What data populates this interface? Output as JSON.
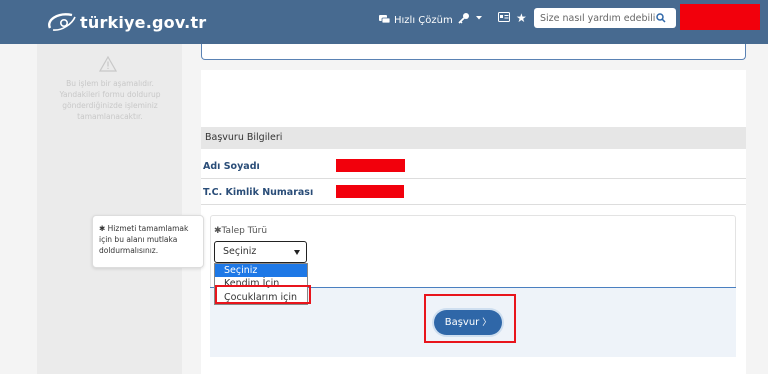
{
  "header": {
    "logo_text": "türkiye.gov.tr",
    "logo_subtext": "",
    "quick_solution_label": "Hızlı Çözüm",
    "search_placeholder": "Size nasıl yardım edebilirim?",
    "icons": [
      "chat-icon",
      "key-icon",
      "id-card-icon",
      "star-icon",
      "search-icon"
    ],
    "colors": {
      "header_bg": "#476a90",
      "redaction": "#f2000c"
    }
  },
  "left_panel": {
    "message": "Bu işlem bir aşamalıdır. Yandakileri formu doldurup gönderdiğinizde işleminiz tamamlanacaktır.",
    "icon": "warning-icon"
  },
  "section": {
    "title": "Başvuru Bilgileri",
    "fields": [
      {
        "label": "Adı Soyadı"
      },
      {
        "label": "T.C. Kimlik Numarası"
      }
    ]
  },
  "tooltip": {
    "text": "✱ Hizmeti tamamlamak için bu alanı mutlaka doldurmalısınız."
  },
  "form": {
    "talep_label": "✱Talep Türü",
    "select_value": "Seçiniz",
    "options": [
      "Seçiniz",
      "Kendim İçin",
      "Çocuklarım için"
    ],
    "submit_label": "Başvur"
  },
  "accent_colors": {
    "primary": "#2f67a8",
    "highlight_red": "#e8141c",
    "selected_option": "#1e78e6"
  }
}
